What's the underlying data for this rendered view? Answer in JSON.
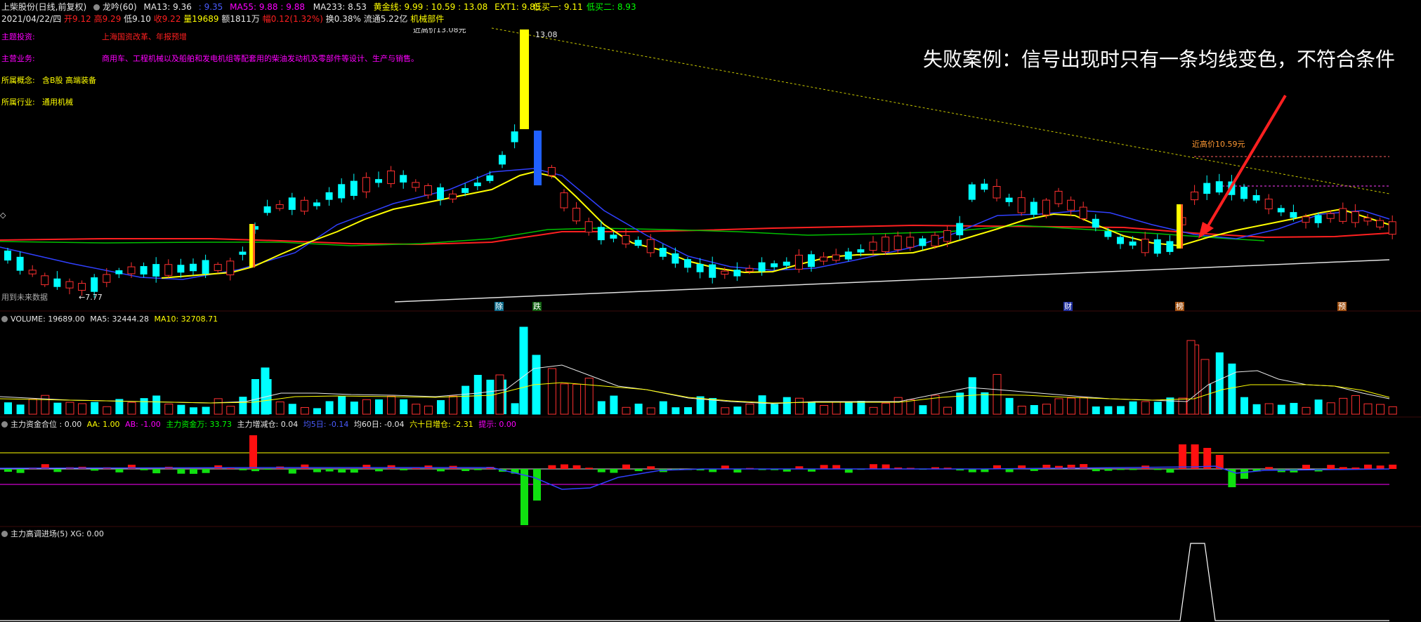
{
  "header": {
    "title": "上柴股份(日线,前复权)",
    "indicator_name": "龙吟(60)",
    "ma13": "MA13: 9.36",
    "ma34": ": 9.35",
    "ma55": "MA55: 9.88",
    "ma89": ": 9.88",
    "ma233": "MA233: 8.53",
    "gold": "黄金线: 9.99",
    "gold_vals": ": 10.59 : 13.08",
    "ext1": "EXT1: 9.85",
    "buy1": "低买一: 9.11",
    "buy2": "低买二: 8.93"
  },
  "quote": {
    "date": "2021/04/22/四",
    "open": "开9.12",
    "high": "高9.29",
    "low": "低9.10",
    "close": "收9.22",
    "volume": "量19689",
    "amount": "额1811万",
    "change": "幅0.12(1.32%)",
    "turnover": "换0.38%",
    "float": "流通5.22亿",
    "sector": "机械部件"
  },
  "info": {
    "l1_label": "主题投资:",
    "l1_value": "上海国资改革、年报预增",
    "l2_label": "主营业务:",
    "l2_value": "商用车、工程机械以及船舶和发电机组等配套用的柴油发动机及零部件等设计、生产与销售。",
    "l3_label": "所属概念:",
    "l3_value": "含B股 高端装备",
    "l4_label": "所属行业:",
    "l4_value": "通用机械"
  },
  "annotation": "失败案例：信号出现时只有一条均线变色，不符合条件",
  "price_labels": {
    "peak": "13.08",
    "recent_high": "近高价10.59元",
    "low": "7.77",
    "future": "用到未来数据",
    "top_partial": "近高价13.08元"
  },
  "event_markers": [
    "除",
    "跌",
    "财",
    "榜",
    "预"
  ],
  "volume_panel": {
    "title": "VOLUME: 19689.00",
    "ma5": "MA5: 32444.28",
    "ma10": "MA10: 32708.71"
  },
  "fund_panel": {
    "t1": "主力资金合位 : 0.00",
    "t2": "AA: 1.00",
    "t3": "AB: -1.00",
    "t4": "主力资金万: 33.73",
    "t5": "主力增减仓: 0.04",
    "t6": "均5日: -0.14",
    "t7": "均60日: -0.04",
    "t8": "六十日增仓: -2.31",
    "t9": "提示: 0.00"
  },
  "entry_panel": {
    "title": "主力高调进场(5) XG: 0.00"
  },
  "colors": {
    "up": "#ff3030",
    "down": "#00ffff",
    "ma13": "#ffff00",
    "ma34": "#3030ff",
    "ma55": "#00c000",
    "ma233": "#ff2020"
  }
}
